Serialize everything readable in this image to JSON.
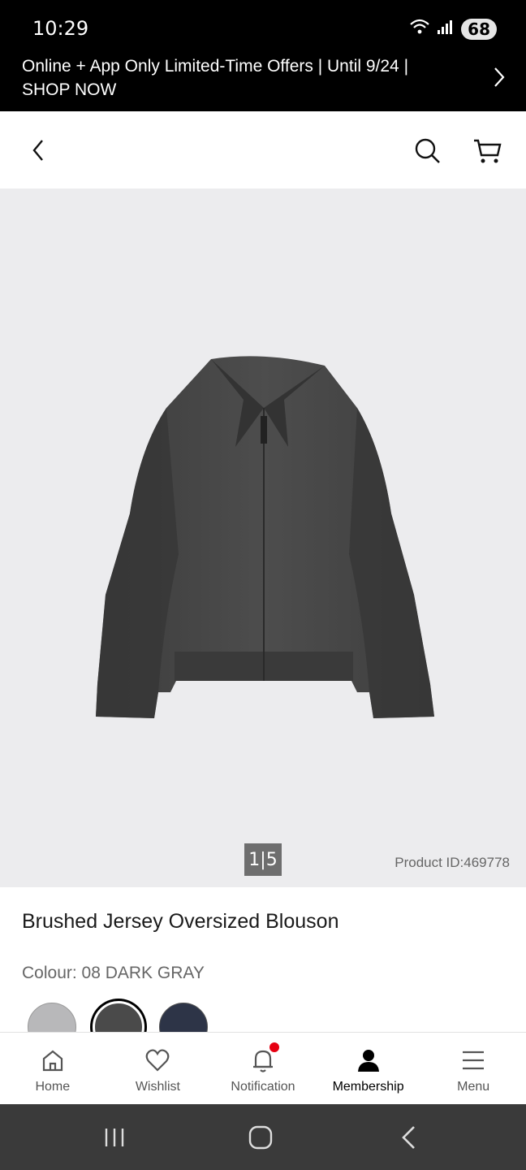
{
  "status_bar": {
    "time": "10:29",
    "battery": "68",
    "wifi_icon": "wifi-icon",
    "signal_icon": "signal-icon"
  },
  "promo": {
    "text": "Online + App Only Limited-Time Offers | Until 9/24 | SHOP NOW",
    "arrow_icon": "chevron-right-icon"
  },
  "header": {
    "back_icon": "chevron-left-icon",
    "search_icon": "search-icon",
    "cart_icon": "cart-icon"
  },
  "gallery": {
    "pager": "1|5",
    "product_id": "Product ID:469778",
    "image": "dark gray zip blouson jacket"
  },
  "product": {
    "title": "Brushed Jersey Oversized Blouson",
    "colour": "Colour: 08 DARK GRAY",
    "swatches": [
      {
        "color": "#b8b8ba",
        "selected": false
      },
      {
        "color": "#4a4a4a",
        "selected": true
      },
      {
        "color": "#2d3447",
        "selected": false
      }
    ]
  },
  "bottom_nav": [
    {
      "label": "Home",
      "icon": "home-icon"
    },
    {
      "label": "Wishlist",
      "icon": "heart-icon"
    },
    {
      "label": "Notification",
      "icon": "bell-icon"
    },
    {
      "label": "Membership",
      "icon": "person-icon",
      "active": true
    },
    {
      "label": "Menu",
      "icon": "menu-icon"
    }
  ],
  "colors": {
    "notification_dot": "#e60012",
    "banner_bg": "#000000",
    "image_bg": "#ececee"
  }
}
